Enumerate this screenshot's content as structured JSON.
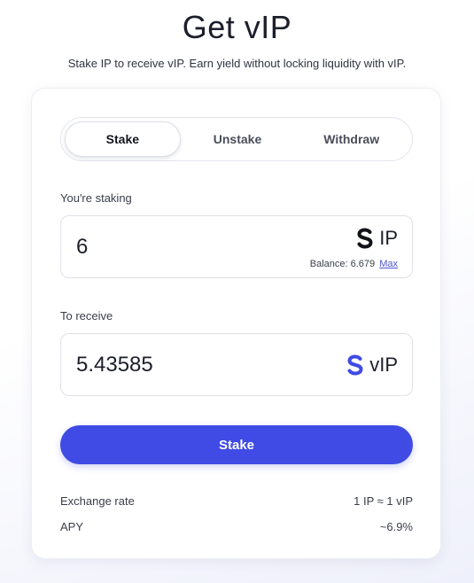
{
  "header": {
    "title": "Get vIP",
    "subtitle": "Stake IP to receive vIP. Earn yield without locking liquidity with vIP."
  },
  "tabs": [
    {
      "label": "Stake",
      "active": true
    },
    {
      "label": "Unstake",
      "active": false
    },
    {
      "label": "Withdraw",
      "active": false
    }
  ],
  "staking": {
    "label": "You're staking",
    "value": "6",
    "token": "IP",
    "token_icon": "ip-logo-icon",
    "balance_label": "Balance: 6.679",
    "max_label": "Max"
  },
  "receive": {
    "label": "To receive",
    "value": "5.43585",
    "token": "vIP",
    "token_icon": "vip-logo-icon"
  },
  "action": {
    "button_label": "Stake",
    "color": "#3f4be4"
  },
  "info": {
    "exchange_rate_label": "Exchange rate",
    "exchange_rate_value": "1 IP ≈ 1 vIP",
    "apy_label": "APY",
    "apy_value": "~6.9%"
  }
}
